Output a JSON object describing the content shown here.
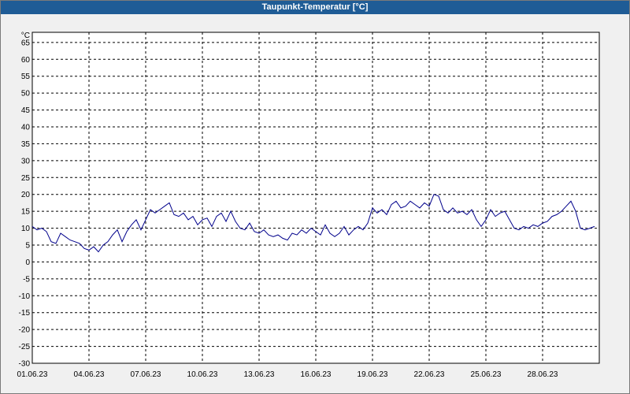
{
  "window": {
    "title": "Taupunkt-Temperatur [°C]"
  },
  "chart_data": {
    "type": "line",
    "title": "Taupunkt-Temperatur [°C]",
    "ylabel": "°C",
    "ylim": [
      -30,
      68
    ],
    "y_ticks": [
      -30,
      -25,
      -20,
      -15,
      -10,
      -5,
      0,
      5,
      10,
      15,
      20,
      25,
      30,
      35,
      40,
      45,
      50,
      55,
      60,
      65
    ],
    "x_range": [
      "2023-06-01",
      "2023-07-01"
    ],
    "x_ticks": [
      "01.06.23",
      "04.06.23",
      "07.06.23",
      "10.06.23",
      "13.06.23",
      "16.06.23",
      "19.06.23",
      "22.06.23",
      "25.06.23",
      "28.06.23"
    ],
    "grid": true,
    "series_color": "#00008b",
    "series": [
      {
        "values": [
          [
            "2023-06-01 00:00",
            10.5
          ],
          [
            "2023-06-01 06:00",
            9.5
          ],
          [
            "2023-06-01 12:00",
            10.0
          ],
          [
            "2023-06-01 18:00",
            9.0
          ],
          [
            "2023-06-02 00:00",
            6.0
          ],
          [
            "2023-06-02 06:00",
            5.5
          ],
          [
            "2023-06-02 12:00",
            8.5
          ],
          [
            "2023-06-02 18:00",
            7.5
          ],
          [
            "2023-06-03 00:00",
            6.5
          ],
          [
            "2023-06-03 06:00",
            6.0
          ],
          [
            "2023-06-03 12:00",
            5.5
          ],
          [
            "2023-06-03 18:00",
            4.0
          ],
          [
            "2023-06-04 00:00",
            3.5
          ],
          [
            "2023-06-04 06:00",
            4.5
          ],
          [
            "2023-06-04 12:00",
            3.0
          ],
          [
            "2023-06-04 18:00",
            5.0
          ],
          [
            "2023-06-05 00:00",
            6.0
          ],
          [
            "2023-06-05 06:00",
            8.0
          ],
          [
            "2023-06-05 12:00",
            9.5
          ],
          [
            "2023-06-05 18:00",
            6.0
          ],
          [
            "2023-06-06 00:00",
            9.0
          ],
          [
            "2023-06-06 06:00",
            11.0
          ],
          [
            "2023-06-06 12:00",
            12.5
          ],
          [
            "2023-06-06 18:00",
            9.5
          ],
          [
            "2023-06-07 00:00",
            12.5
          ],
          [
            "2023-06-07 06:00",
            15.5
          ],
          [
            "2023-06-07 12:00",
            14.5
          ],
          [
            "2023-06-07 18:00",
            15.5
          ],
          [
            "2023-06-08 00:00",
            16.5
          ],
          [
            "2023-06-08 06:00",
            17.5
          ],
          [
            "2023-06-08 12:00",
            14.0
          ],
          [
            "2023-06-08 18:00",
            13.5
          ],
          [
            "2023-06-09 00:00",
            14.5
          ],
          [
            "2023-06-09 06:00",
            12.5
          ],
          [
            "2023-06-09 12:00",
            13.5
          ],
          [
            "2023-06-09 18:00",
            11.0
          ],
          [
            "2023-06-10 00:00",
            12.5
          ],
          [
            "2023-06-10 06:00",
            13.0
          ],
          [
            "2023-06-10 12:00",
            10.5
          ],
          [
            "2023-06-10 18:00",
            13.5
          ],
          [
            "2023-06-11 00:00",
            14.5
          ],
          [
            "2023-06-11 06:00",
            12.0
          ],
          [
            "2023-06-11 12:00",
            15.0
          ],
          [
            "2023-06-11 18:00",
            12.0
          ],
          [
            "2023-06-12 00:00",
            10.0
          ],
          [
            "2023-06-12 06:00",
            9.5
          ],
          [
            "2023-06-12 12:00",
            11.5
          ],
          [
            "2023-06-12 18:00",
            9.0
          ],
          [
            "2023-06-13 00:00",
            8.5
          ],
          [
            "2023-06-13 06:00",
            9.5
          ],
          [
            "2023-06-13 12:00",
            8.0
          ],
          [
            "2023-06-13 18:00",
            7.5
          ],
          [
            "2023-06-14 00:00",
            8.0
          ],
          [
            "2023-06-14 06:00",
            7.0
          ],
          [
            "2023-06-14 12:00",
            6.5
          ],
          [
            "2023-06-14 18:00",
            8.5
          ],
          [
            "2023-06-15 00:00",
            8.0
          ],
          [
            "2023-06-15 06:00",
            9.5
          ],
          [
            "2023-06-15 12:00",
            8.5
          ],
          [
            "2023-06-15 18:00",
            10.0
          ],
          [
            "2023-06-16 00:00",
            9.0
          ],
          [
            "2023-06-16 06:00",
            8.0
          ],
          [
            "2023-06-16 12:00",
            11.0
          ],
          [
            "2023-06-16 18:00",
            8.5
          ],
          [
            "2023-06-17 00:00",
            7.5
          ],
          [
            "2023-06-17 06:00",
            8.5
          ],
          [
            "2023-06-17 12:00",
            10.5
          ],
          [
            "2023-06-17 18:00",
            8.0
          ],
          [
            "2023-06-18 00:00",
            9.5
          ],
          [
            "2023-06-18 06:00",
            10.5
          ],
          [
            "2023-06-18 12:00",
            9.5
          ],
          [
            "2023-06-18 18:00",
            11.5
          ],
          [
            "2023-06-19 00:00",
            16.0
          ],
          [
            "2023-06-19 06:00",
            14.5
          ],
          [
            "2023-06-19 12:00",
            15.5
          ],
          [
            "2023-06-19 18:00",
            14.0
          ],
          [
            "2023-06-20 00:00",
            17.0
          ],
          [
            "2023-06-20 06:00",
            18.0
          ],
          [
            "2023-06-20 12:00",
            16.0
          ],
          [
            "2023-06-20 18:00",
            16.5
          ],
          [
            "2023-06-21 00:00",
            18.0
          ],
          [
            "2023-06-21 06:00",
            17.0
          ],
          [
            "2023-06-21 12:00",
            16.0
          ],
          [
            "2023-06-21 18:00",
            17.5
          ],
          [
            "2023-06-22 00:00",
            16.5
          ],
          [
            "2023-06-22 06:00",
            20.0
          ],
          [
            "2023-06-22 12:00",
            19.5
          ],
          [
            "2023-06-22 18:00",
            15.5
          ],
          [
            "2023-06-23 00:00",
            14.5
          ],
          [
            "2023-06-23 06:00",
            16.0
          ],
          [
            "2023-06-23 12:00",
            14.5
          ],
          [
            "2023-06-23 18:00",
            15.0
          ],
          [
            "2023-06-24 00:00",
            14.0
          ],
          [
            "2023-06-24 06:00",
            15.5
          ],
          [
            "2023-06-24 12:00",
            12.5
          ],
          [
            "2023-06-24 18:00",
            10.5
          ],
          [
            "2023-06-25 00:00",
            12.5
          ],
          [
            "2023-06-25 06:00",
            15.5
          ],
          [
            "2023-06-25 12:00",
            13.5
          ],
          [
            "2023-06-25 18:00",
            14.5
          ],
          [
            "2023-06-26 00:00",
            15.0
          ],
          [
            "2023-06-26 06:00",
            12.5
          ],
          [
            "2023-06-26 12:00",
            10.0
          ],
          [
            "2023-06-26 18:00",
            9.5
          ],
          [
            "2023-06-27 00:00",
            10.5
          ],
          [
            "2023-06-27 06:00",
            10.0
          ],
          [
            "2023-06-27 12:00",
            11.0
          ],
          [
            "2023-06-27 18:00",
            10.5
          ],
          [
            "2023-06-28 00:00",
            11.5
          ],
          [
            "2023-06-28 06:00",
            12.0
          ],
          [
            "2023-06-28 12:00",
            13.5
          ],
          [
            "2023-06-28 18:00",
            14.0
          ],
          [
            "2023-06-29 00:00",
            15.0
          ],
          [
            "2023-06-29 06:00",
            16.5
          ],
          [
            "2023-06-29 12:00",
            18.0
          ],
          [
            "2023-06-29 18:00",
            15.0
          ],
          [
            "2023-06-30 00:00",
            10.0
          ],
          [
            "2023-06-30 06:00",
            9.5
          ],
          [
            "2023-06-30 12:00",
            10.0
          ],
          [
            "2023-06-30 18:00",
            10.5
          ]
        ]
      }
    ]
  }
}
